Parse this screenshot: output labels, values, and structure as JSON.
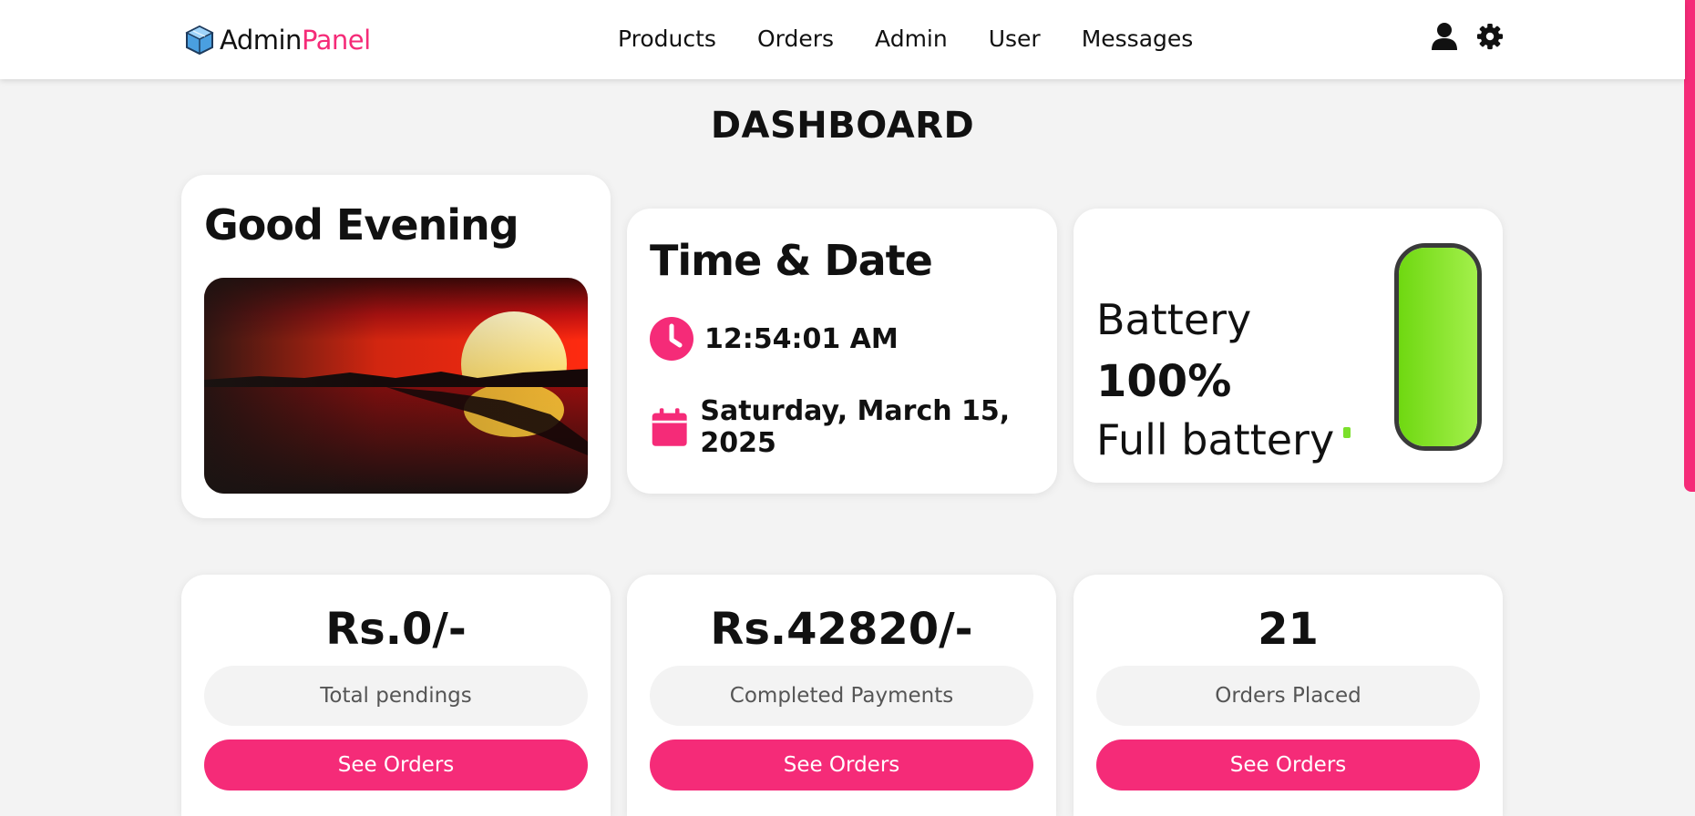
{
  "brand": {
    "part1": "Admin",
    "part2": "Panel"
  },
  "nav": [
    "Products",
    "Orders",
    "Admin",
    "User",
    "Messages"
  ],
  "header_icons": [
    "user-icon",
    "gear-icon"
  ],
  "page_title": "DASHBOARD",
  "greeting": {
    "title": "Good Evening"
  },
  "timedate": {
    "title": "Time & Date",
    "time": "12:54:01 AM",
    "date": "Saturday, March 15, 2025"
  },
  "battery": {
    "label": "Battery",
    "percent_text": "100%",
    "status": "Full battery",
    "level": 1.0
  },
  "stats": [
    {
      "value": "Rs.0/-",
      "label": "Total pendings",
      "button": "See Orders"
    },
    {
      "value": "Rs.42820/-",
      "label": "Completed Payments",
      "button": "See Orders"
    },
    {
      "value": "21",
      "label": "Orders Placed",
      "button": "See Orders"
    }
  ],
  "colors": {
    "accent": "#f52b78",
    "battery_fill": "#7be02b",
    "background": "#f3f3f3"
  }
}
